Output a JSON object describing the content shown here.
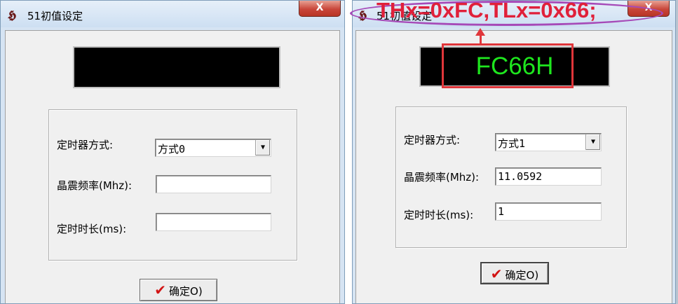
{
  "left_window": {
    "title": "51初值设定",
    "close_glyph": "X",
    "display_text": "",
    "mode_label": "定时器方式:",
    "mode_value": "方式0",
    "crystal_label": "晶震频率(Mhz):",
    "crystal_value": "",
    "duration_label": "定时时长(ms):",
    "duration_value": "",
    "ok_label": "确定O)"
  },
  "right_window": {
    "title": "51初值设定",
    "close_glyph": "X",
    "display_text": "FC66H",
    "mode_label": "定时器方式:",
    "mode_value": "方式1",
    "crystal_label": "晶震频率(Mhz):",
    "crystal_value": "11.0592",
    "duration_label": "定时时长(ms):",
    "duration_value": "1",
    "ok_label": "确定O)"
  },
  "annotation": {
    "text": "THx=0xFC,TLx=0x66;",
    "color": "#e0203a",
    "ellipse_color": "#a64ab8"
  },
  "icons": {
    "app": "app-icon",
    "check": "check-icon",
    "dropdown": "dropdown-arrow-icon"
  }
}
